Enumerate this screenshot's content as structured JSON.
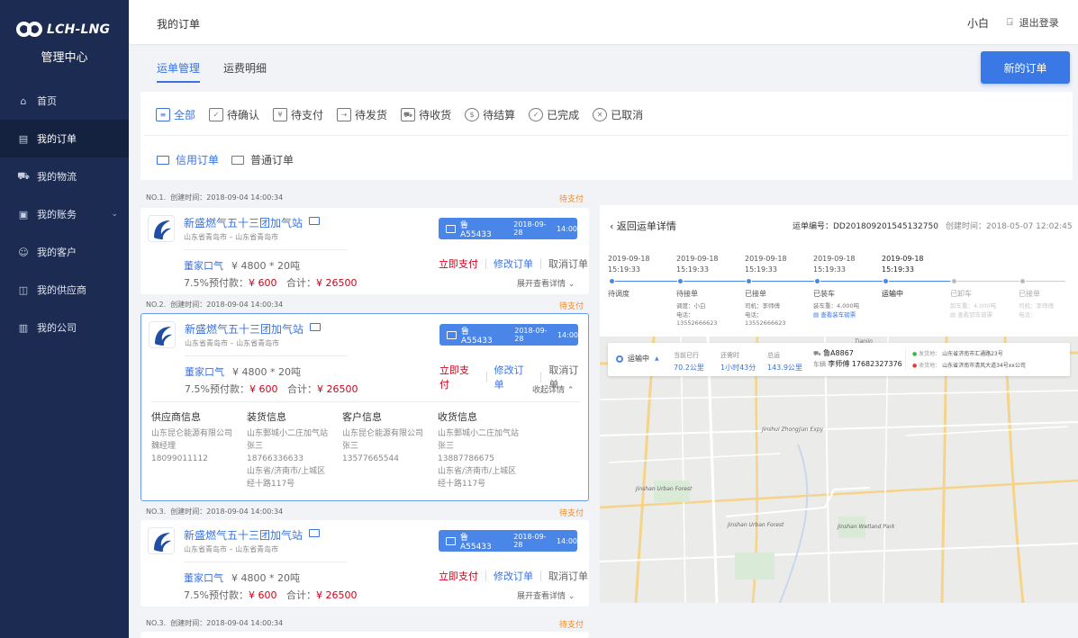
{
  "brand": {
    "name": "LCH-LNG",
    "subtitle": "管理中心"
  },
  "sidebar": {
    "items": [
      {
        "label": "首页",
        "icon": "home-icon"
      },
      {
        "label": "我的订单",
        "icon": "order-doc-icon",
        "active": true
      },
      {
        "label": "我的物流",
        "icon": "truck-icon"
      },
      {
        "label": "我的账务",
        "icon": "wallet-icon",
        "caret": true
      },
      {
        "label": "我的客户",
        "icon": "customers-icon"
      },
      {
        "label": "我的供应商",
        "icon": "supplier-icon"
      },
      {
        "label": "我的公司",
        "icon": "company-icon"
      }
    ]
  },
  "header": {
    "title": "我的订单",
    "user": "小白",
    "logout": "退出登录"
  },
  "subtabs": [
    {
      "label": "运单管理",
      "active": true
    },
    {
      "label": "运费明细"
    }
  ],
  "new_order_label": "新的订单",
  "status_tabs": [
    {
      "label": "全部",
      "icon": "list-icon",
      "active": true
    },
    {
      "label": "待确认",
      "icon": "confirm-icon"
    },
    {
      "label": "待支付",
      "icon": "pay-icon"
    },
    {
      "label": "待发货",
      "icon": "ship-icon"
    },
    {
      "label": "待收货",
      "icon": "receive-icon"
    },
    {
      "label": "待结算",
      "icon": "settle-icon"
    },
    {
      "label": "已完成",
      "icon": "check-circle-icon"
    },
    {
      "label": "已取消",
      "icon": "x-circle-icon"
    }
  ],
  "type_tabs": [
    {
      "label": "信用订单",
      "active": true
    },
    {
      "label": "普通订单"
    }
  ],
  "orders": [
    {
      "no": "NO.1.",
      "created": "创建时间：2018-09-04  14:00:34",
      "status": "待支付",
      "station": "新盛燃气五十三团加气站",
      "addr": "山东省青岛市 – 山东省青岛市",
      "plate": "鲁A55433",
      "date": "2018-09-28",
      "time": "14:00",
      "product": "董家口气",
      "qty": "¥ 4800 * 20吨",
      "prepay_label": "7.5%预付款：",
      "prepay": "¥ 600",
      "total_label": "合计：",
      "total": "¥ 26500",
      "pay": "立即支付",
      "modify": "修改订单",
      "cancel": "取消订单",
      "toggle": "展开查看详情"
    },
    {
      "no": "NO.2.",
      "created": "创建时间：2018-09-04  14:00:34",
      "status": "待支付",
      "station": "新盛燃气五十三团加气站",
      "addr": "山东省青岛市 – 山东省青岛市",
      "plate": "鲁A55433",
      "date": "2018-09-28",
      "time": "14:00",
      "product": "董家口气",
      "qty": "¥ 4800 * 20吨",
      "prepay_label": "7.5%预付款：",
      "prepay": "¥ 600",
      "total_label": "合计：",
      "total": "¥ 26500",
      "pay": "立即支付",
      "modify": "修改订单",
      "cancel": "取消订单",
      "toggle": "收起详情",
      "details": [
        {
          "title": "供应商信息",
          "lines": [
            "山东昆仑能源有限公司",
            "魏经理",
            "18099011112"
          ]
        },
        {
          "title": "装货信息",
          "lines": [
            "山东鄄城小二庄加气站",
            "张三",
            "18766336633",
            "山东省/济南市/上城区",
            "经十路117号"
          ]
        },
        {
          "title": "客户信息",
          "lines": [
            "山东昆仑能源有限公司",
            "张三",
            "13577665544"
          ]
        },
        {
          "title": "收货信息",
          "lines": [
            "山东鄄城小二庄加气站",
            "张三",
            "13887786675",
            "山东省/济南市/上城区",
            "经十路117号"
          ]
        }
      ]
    },
    {
      "no": "NO.3.",
      "created": "创建时间：2018-09-04  14:00:34",
      "status": "待支付",
      "station": "新盛燃气五十三团加气站",
      "addr": "山东省青岛市 – 山东省青岛市",
      "plate": "鲁A55433",
      "date": "2018-09-28",
      "time": "14:00",
      "product": "董家口气",
      "qty": "¥ 4800 * 20吨",
      "prepay_label": "7.5%预付款：",
      "prepay": "¥ 600",
      "total_label": "合计：",
      "total": "¥ 26500",
      "pay": "立即支付",
      "modify": "修改订单",
      "cancel": "取消订单",
      "toggle": "展开查看详情"
    },
    {
      "no": "NO.3.",
      "created": "创建时间：2018-09-04  14:00:34",
      "status": "待支付"
    }
  ],
  "waybill": {
    "back": "返回运单详情",
    "number": "运单编号：DD201809201545132750",
    "created": "创建时间：2018-05-07  12:02:45",
    "steps": [
      {
        "date": "2019-09-18",
        "time": "15:19:33",
        "label": "待调度"
      },
      {
        "date": "2019-09-18",
        "time": "15:19:33",
        "label": "待接单",
        "sub": [
          "调度：小白",
          "电话：",
          "13552666623"
        ]
      },
      {
        "date": "2019-09-18",
        "time": "15:19:33",
        "label": "已接单",
        "sub": [
          "司机：李师傅",
          "电话：",
          "13552666623"
        ]
      },
      {
        "date": "2019-09-18",
        "time": "15:19:33",
        "label": "已装车",
        "sub": [
          "装车重：4,000吨"
        ],
        "link": "查看装车磅票"
      },
      {
        "date": "2019-09-18",
        "time": "15:19:33",
        "label": "运输中",
        "now": true
      },
      {
        "label": "已卸车",
        "sub": [
          "卸车重：4,000吨"
        ],
        "link": "查看卸车磅票",
        "gray": true
      },
      {
        "label": "已接单",
        "sub": [
          "司机：李师傅",
          "电话："
        ],
        "gray": true
      }
    ],
    "map_card": {
      "status": "运输中",
      "traveled_label": "当前已行",
      "traveled": "70.2公里",
      "remaining_label": "还需时",
      "remaining": "1小时43分",
      "total_label": "总运",
      "total": "143.9公里",
      "plate": "鲁A8867",
      "driver_label": "车辆",
      "driver": "李师傅 17682327376",
      "from_label": "发货地：",
      "from": "山东省济南市汇通路23号",
      "to_label": "收货地：",
      "to": "山东省济南市清风大道34号xx公司"
    },
    "map_labels": [
      "Tianjin",
      "Jinshan Urban Forest",
      "Jinshan Wetland Park",
      "Jinshan Urban Forest",
      "Jinshui Zhongjian Expy"
    ]
  }
}
